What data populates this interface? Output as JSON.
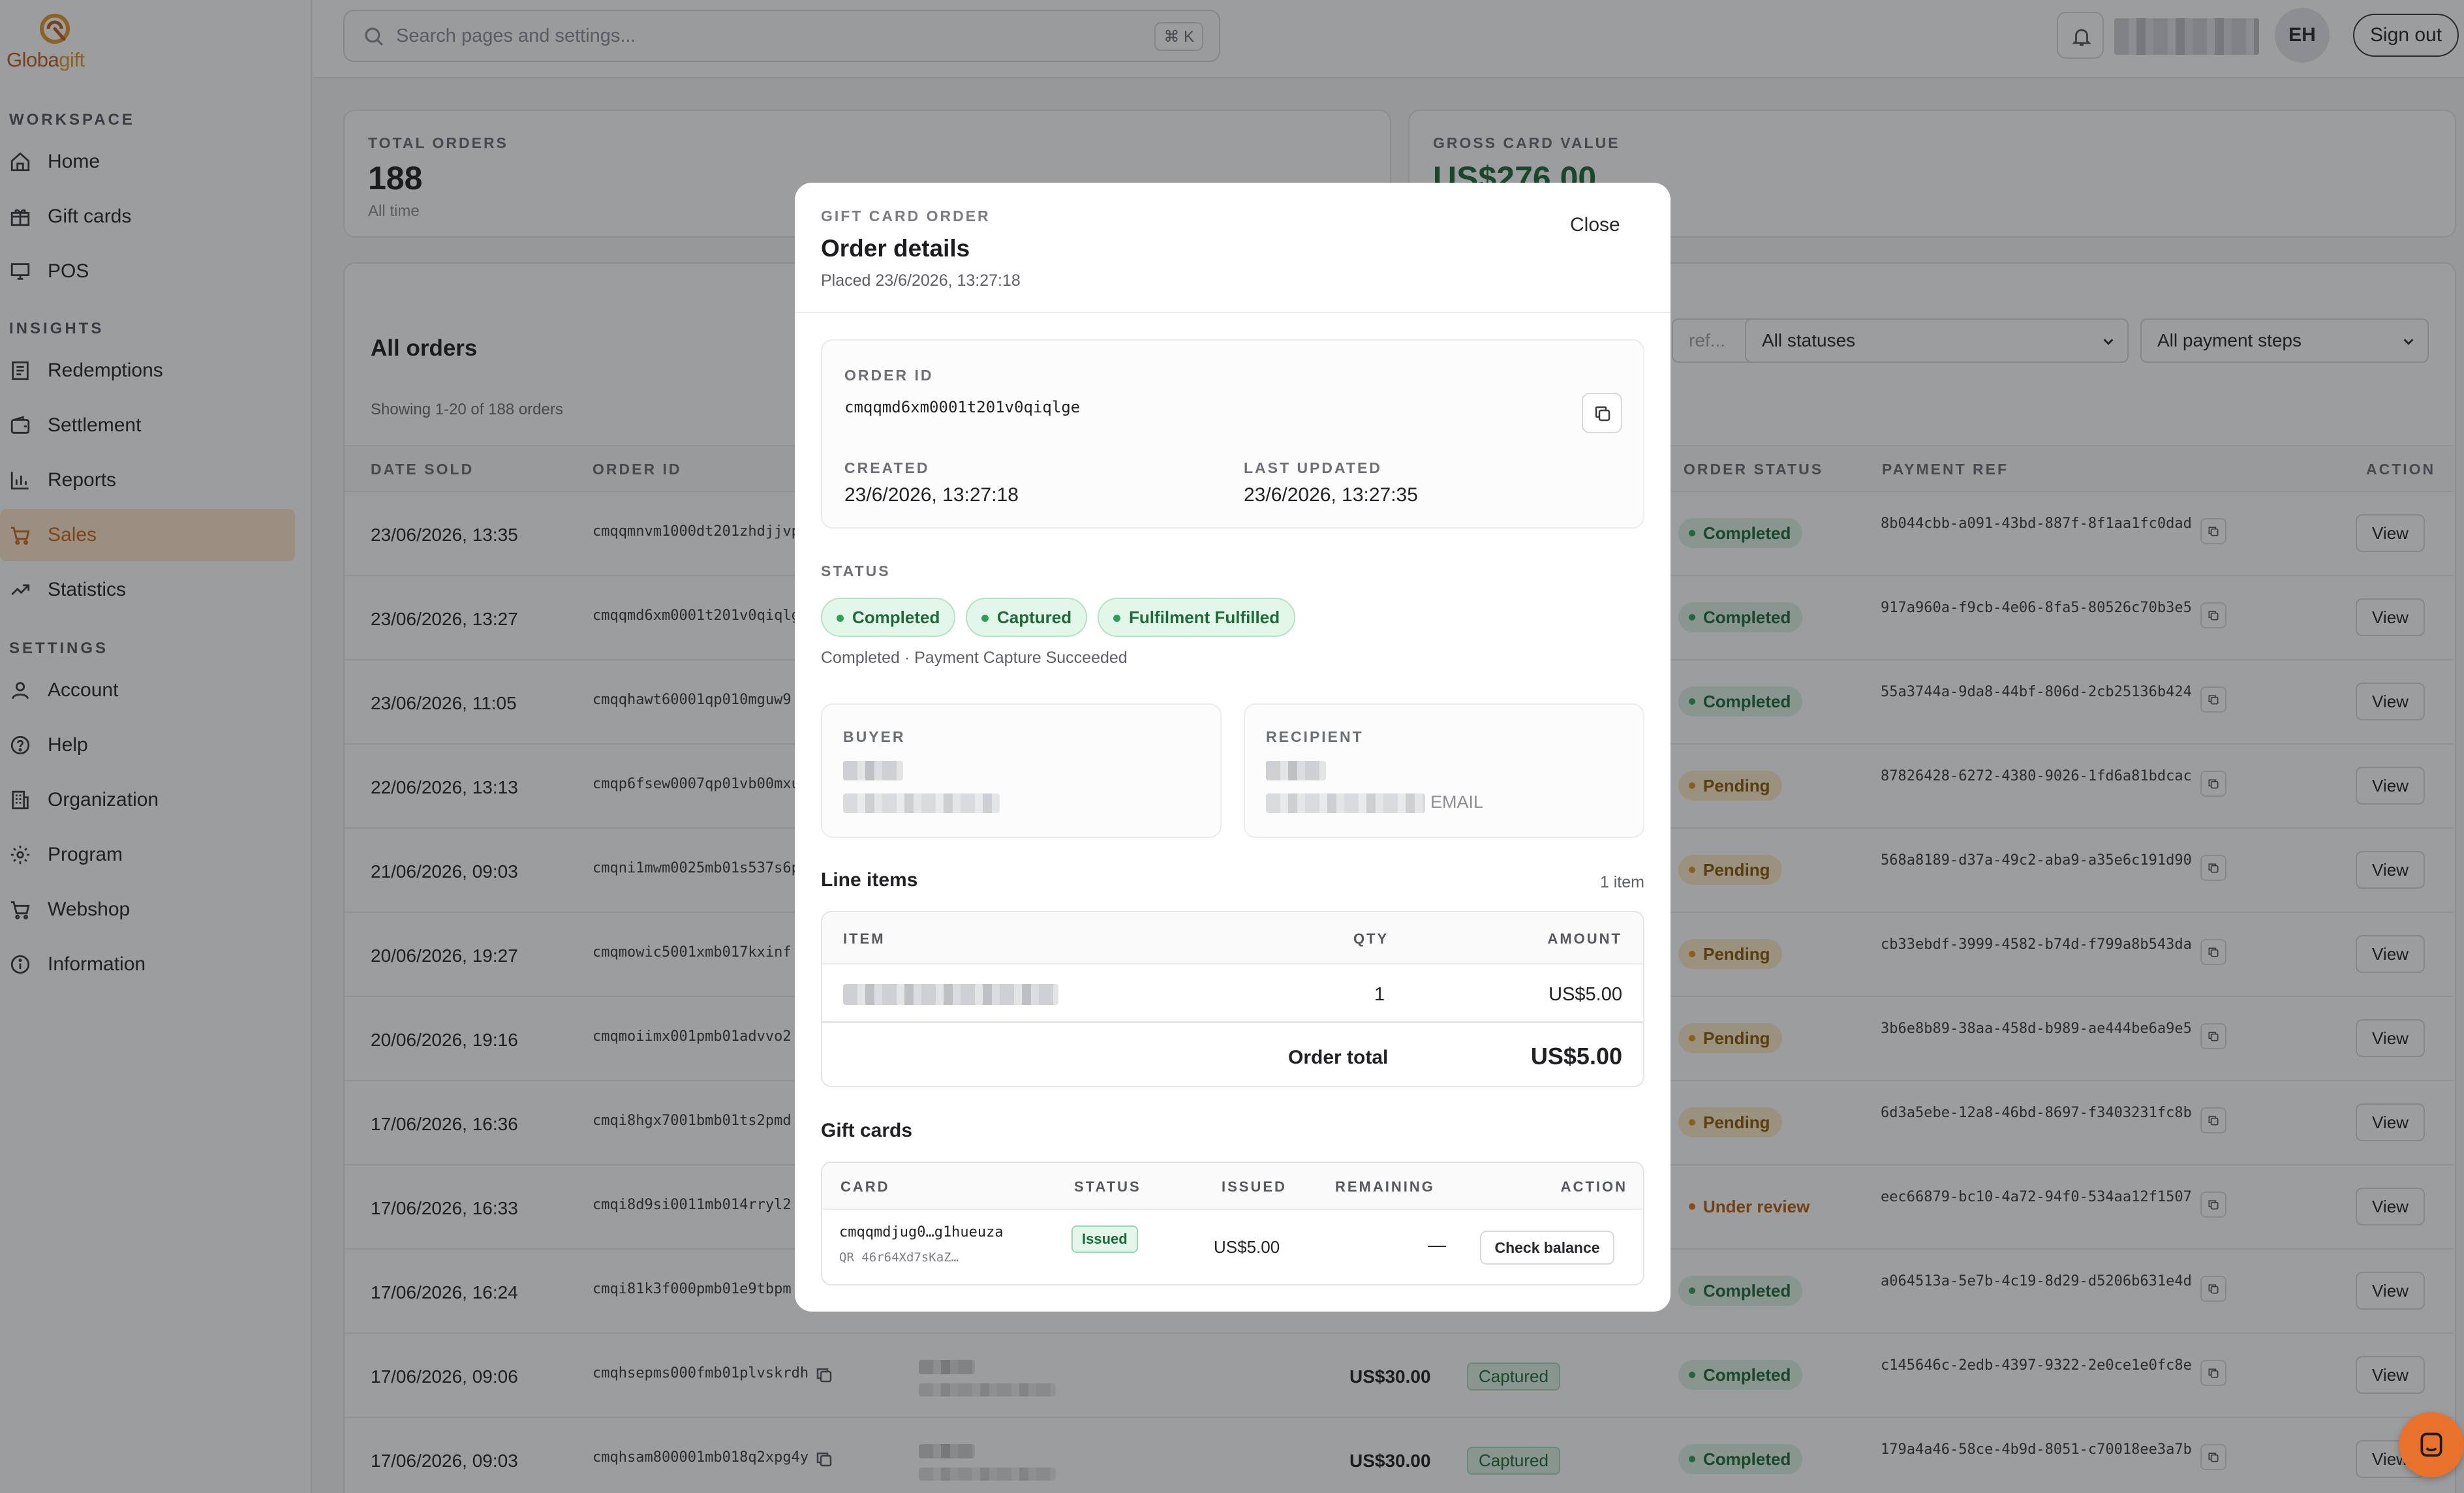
{
  "brand": {
    "name_part1": "Globa",
    "name_part2": "gift"
  },
  "sidebar": {
    "sections": [
      {
        "title": "WORKSPACE",
        "items": [
          {
            "label": "Home",
            "icon": "home-icon"
          },
          {
            "label": "Gift cards",
            "icon": "gift-icon"
          },
          {
            "label": "POS",
            "icon": "monitor-icon"
          }
        ]
      },
      {
        "title": "INSIGHTS",
        "items": [
          {
            "label": "Redemptions",
            "icon": "receipt-icon"
          },
          {
            "label": "Settlement",
            "icon": "wallet-icon"
          },
          {
            "label": "Reports",
            "icon": "bar-chart-icon"
          },
          {
            "label": "Sales",
            "icon": "cart-icon",
            "active": true
          },
          {
            "label": "Statistics",
            "icon": "trend-icon"
          }
        ]
      },
      {
        "title": "SETTINGS",
        "items": [
          {
            "label": "Account",
            "icon": "user-icon"
          },
          {
            "label": "Help",
            "icon": "help-icon"
          },
          {
            "label": "Organization",
            "icon": "building-icon"
          },
          {
            "label": "Program",
            "icon": "gear-icon"
          },
          {
            "label": "Webshop",
            "icon": "cart-icon"
          },
          {
            "label": "Information",
            "icon": "info-icon"
          }
        ]
      }
    ]
  },
  "topbar": {
    "search_placeholder": "Search pages and settings...",
    "search_shortcut": "⌘ K",
    "avatar_initials": "EH",
    "sign_out_label": "Sign out"
  },
  "stats": [
    {
      "label": "TOTAL ORDERS",
      "value": "188",
      "sub": "All time"
    },
    {
      "label": "GROSS CARD VALUE",
      "value": "US$276.00",
      "sub": ""
    }
  ],
  "orders": {
    "title": "All orders",
    "showing": "Showing 1-20 of 188 orders",
    "search_placeholder_fragment": "ref...",
    "filter_status": "All statuses",
    "filter_payment": "All payment steps",
    "columns": {
      "date": "DATE SOLD",
      "order_id": "ORDER ID",
      "order_status": "ORDER STATUS",
      "payment_ref": "PAYMENT REF",
      "action": "ACTION"
    },
    "view_label": "View",
    "rows": [
      {
        "date": "23/06/2026, 13:35",
        "order_id": "cmqqmnvm1000dt201zhdjjvp",
        "status": "Completed",
        "status_kind": "completed",
        "ref": "8b044cbb-a091-43bd-887f-8f1aa1fc0dad"
      },
      {
        "date": "23/06/2026, 13:27",
        "order_id": "cmqqmd6xm0001t201v0qiqlge",
        "status": "Completed",
        "status_kind": "completed",
        "ref": "917a960a-f9cb-4e06-8fa5-80526c70b3e5"
      },
      {
        "date": "23/06/2026, 11:05",
        "order_id": "cmqqhawt60001qp010mguw9",
        "status": "Completed",
        "status_kind": "completed",
        "ref": "55a3744a-9da8-44bf-806d-2cb25136b424"
      },
      {
        "date": "22/06/2026, 13:13",
        "order_id": "cmqp6fsew0007qp01vb00mxu",
        "status": "Pending",
        "status_kind": "pending",
        "ref": "87826428-6272-4380-9026-1fd6a81bdcac"
      },
      {
        "date": "21/06/2026, 09:03",
        "order_id": "cmqni1mwm0025mb01s537s6p",
        "status": "Pending",
        "status_kind": "pending",
        "ref": "568a8189-d37a-49c2-aba9-a35e6c191d90"
      },
      {
        "date": "20/06/2026, 19:27",
        "order_id": "cmqmowic5001xmb017kxinf",
        "status": "Pending",
        "status_kind": "pending",
        "ref": "cb33ebdf-3999-4582-b74d-f799a8b543da"
      },
      {
        "date": "20/06/2026, 19:16",
        "order_id": "cmqmoiimx001pmb01advvo2",
        "status": "Pending",
        "status_kind": "pending",
        "ref": "3b6e8b89-38aa-458d-b989-ae444be6a9e5"
      },
      {
        "date": "17/06/2026, 16:36",
        "order_id": "cmqi8hgx7001bmb01ts2pmd",
        "status": "Pending",
        "status_kind": "pending",
        "ref": "6d3a5ebe-12a8-46bd-8697-f3403231fc8b"
      },
      {
        "date": "17/06/2026, 16:33",
        "order_id": "cmqi8d9si0011mb014rryl2",
        "status": "Under review",
        "status_kind": "review",
        "ref": "eec66879-bc10-4a72-94f0-534aa12f1507"
      },
      {
        "date": "17/06/2026, 16:24",
        "order_id": "cmqi81k3f000pmb01e9tbpm",
        "status": "Completed",
        "status_kind": "completed",
        "ref": "a064513a-5e7b-4c19-8d29-d5206b631e4d"
      },
      {
        "date": "17/06/2026, 09:06",
        "order_id": "cmqhsepms000fmb01plvskrdh",
        "amount": "US$30.00",
        "pay_step": "Captured",
        "status": "Completed",
        "status_kind": "completed",
        "ref": "c145646c-2edb-4397-9322-2e0ce1e0fc8e"
      },
      {
        "date": "17/06/2026, 09:03",
        "order_id": "cmqhsam800001mb018q2xpg4y",
        "amount": "US$30.00",
        "pay_step": "Captured",
        "status": "Completed",
        "status_kind": "completed",
        "ref": "179a4a46-58ce-4b9d-8051-c70018ee3a7b"
      }
    ]
  },
  "modal": {
    "eyebrow": "GIFT CARD ORDER",
    "title": "Order details",
    "placed": "Placed 23/6/2026, 13:27:18",
    "close_label": "Close",
    "order_id_label": "ORDER ID",
    "order_id": "cmqqmd6xm0001t201v0qiqlge",
    "created_label": "CREATED",
    "created": "23/6/2026, 13:27:18",
    "updated_label": "LAST UPDATED",
    "updated": "23/6/2026, 13:27:35",
    "status_label": "STATUS",
    "status_pills": [
      "Completed",
      "Captured",
      "Fulfilment Fulfilled"
    ],
    "status_summary": "Completed · Payment Capture Succeeded",
    "buyer_label": "BUYER",
    "recipient_label": "RECIPIENT",
    "recipient_channel": "EMAIL",
    "line_items_title": "Line items",
    "line_items_count": "1 item",
    "line_items_cols": {
      "item": "ITEM",
      "qty": "QTY",
      "amount": "AMOUNT"
    },
    "line_items": [
      {
        "qty": "1",
        "amount": "US$5.00"
      }
    ],
    "order_total_label": "Order total",
    "order_total": "US$5.00",
    "gift_cards_title": "Gift cards",
    "gift_cards_cols": {
      "card": "CARD",
      "status": "STATUS",
      "issued": "ISSUED",
      "remaining": "REMAINING",
      "action": "ACTION"
    },
    "gift_cards": [
      {
        "card": "cmqqmdjug0…g1hueuza",
        "qr": "QR 46r64Xd7sKaZ…",
        "status": "Issued",
        "issued": "US$5.00",
        "remaining": "—",
        "action": "Check balance"
      }
    ]
  }
}
